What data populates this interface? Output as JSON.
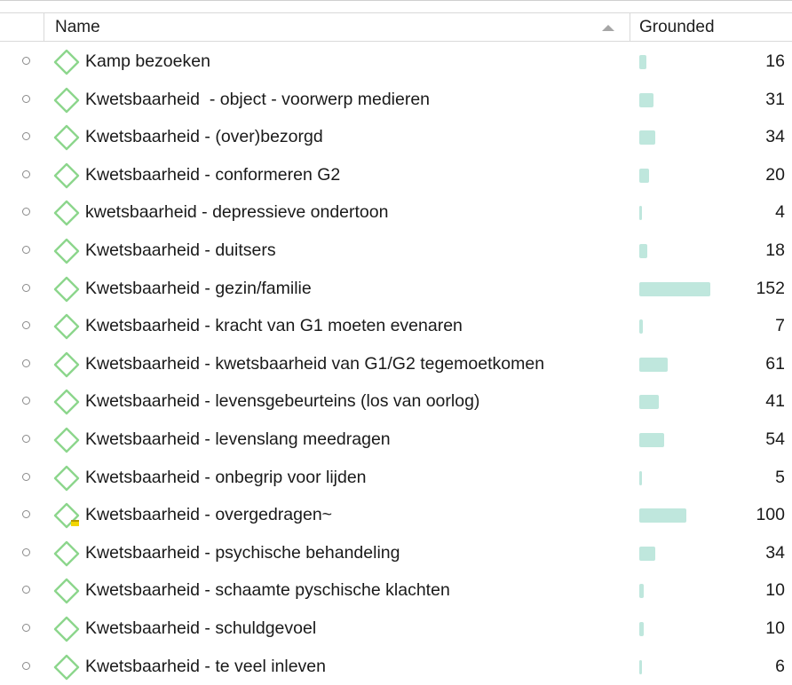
{
  "header": {
    "name_label": "Name",
    "grounded_label": "Grounded",
    "sort_icon": "triangle-up-icon"
  },
  "colors": {
    "code_icon": "#8cd68c",
    "bar": "#bfe7dd",
    "memo_flag": "#f2d600"
  },
  "bar_scale_max": 152,
  "rows": [
    {
      "label": "Kamp bezoeken",
      "grounded": 16,
      "memo": false
    },
    {
      "label": "Kwetsbaarheid  - object - voorwerp medieren",
      "grounded": 31,
      "memo": false
    },
    {
      "label": "Kwetsbaarheid - (over)bezorgd",
      "grounded": 34,
      "memo": false
    },
    {
      "label": "Kwetsbaarheid - conformeren G2",
      "grounded": 20,
      "memo": false
    },
    {
      "label": "kwetsbaarheid - depressieve ondertoon",
      "grounded": 4,
      "memo": false
    },
    {
      "label": "Kwetsbaarheid - duitsers",
      "grounded": 18,
      "memo": false
    },
    {
      "label": "Kwetsbaarheid - gezin/familie",
      "grounded": 152,
      "memo": false
    },
    {
      "label": "Kwetsbaarheid - kracht van G1 moeten evenaren",
      "grounded": 7,
      "memo": false
    },
    {
      "label": "Kwetsbaarheid - kwetsbaarheid van G1/G2 tegemoetkomen",
      "grounded": 61,
      "memo": false
    },
    {
      "label": "Kwetsbaarheid - levensgebeurteins (los van oorlog)",
      "grounded": 41,
      "memo": false
    },
    {
      "label": "Kwetsbaarheid - levenslang meedragen",
      "grounded": 54,
      "memo": false
    },
    {
      "label": "Kwetsbaarheid - onbegrip voor lijden",
      "grounded": 5,
      "memo": false
    },
    {
      "label": "Kwetsbaarheid - overgedragen~",
      "grounded": 100,
      "memo": true
    },
    {
      "label": "Kwetsbaarheid - psychische behandeling",
      "grounded": 34,
      "memo": false
    },
    {
      "label": "Kwetsbaarheid - schaamte pyschische klachten",
      "grounded": 10,
      "memo": false
    },
    {
      "label": "Kwetsbaarheid - schuldgevoel",
      "grounded": 10,
      "memo": false
    },
    {
      "label": "Kwetsbaarheid - te veel inleven",
      "grounded": 6,
      "memo": false
    }
  ]
}
